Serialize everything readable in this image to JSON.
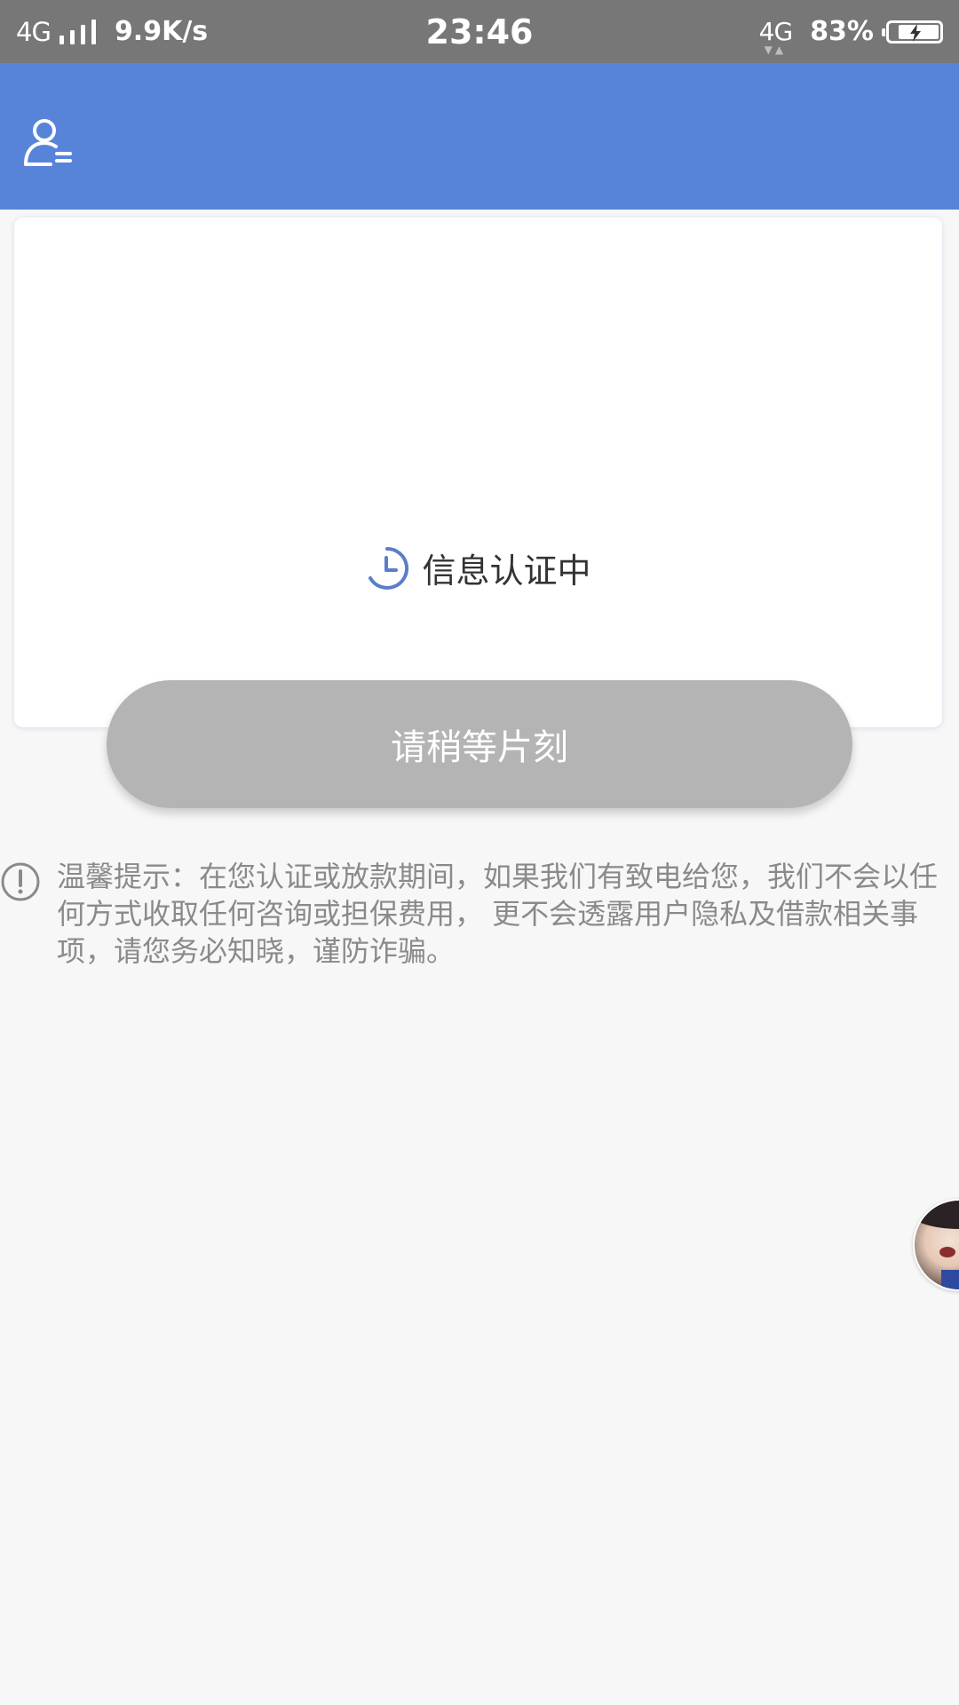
{
  "status_bar": {
    "network_left": "4G",
    "net_speed": "9.9K/s",
    "time": "23:46",
    "network_right": "4G",
    "battery_percent": "83%",
    "battery_level": 0.83,
    "charging": true
  },
  "header": {
    "profile_icon": "user-menu-icon",
    "color": "#5784d9"
  },
  "card": {
    "status_icon": "clock-icon",
    "status_text": "信息认证中"
  },
  "wait_button": {
    "label": "请稍等片刻",
    "color": "#b4b4b4"
  },
  "notice": {
    "icon": "exclamation-circle-icon",
    "text": "温馨提示：在您认证或放款期间，如果我们有致电给您，我们不会以任何方式收取任何咨询或担保费用， 更不会透露用户隐私及借款相关事项，请您务必知晓，谨防诈骗。"
  },
  "floating_button": {
    "icon": "avatar-image"
  }
}
